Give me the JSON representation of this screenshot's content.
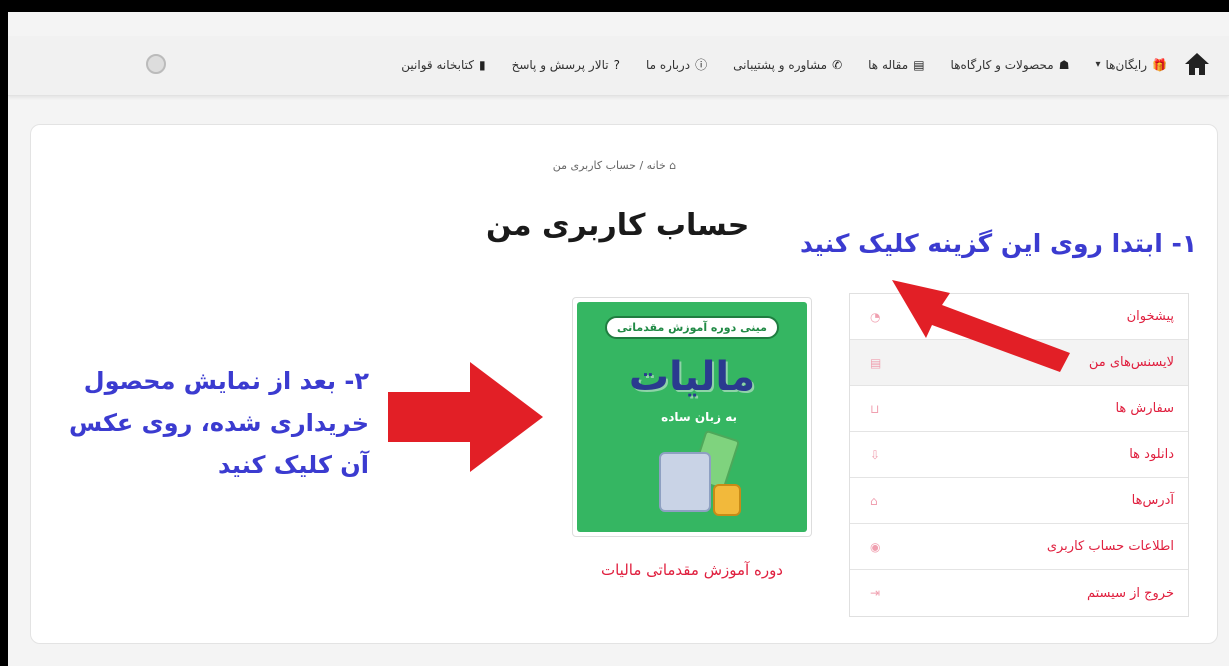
{
  "nav": {
    "items": [
      {
        "label": "رایگان‌ها",
        "icon": "gift-icon",
        "glyph": "🎁",
        "has_dropdown": true
      },
      {
        "label": "محصولات و کارگاه‌ها",
        "icon": "award-icon",
        "glyph": "☗"
      },
      {
        "label": "مقاله ها",
        "icon": "newspaper-icon",
        "glyph": "▤"
      },
      {
        "label": "مشاوره و پشتیبانی",
        "icon": "phone-icon",
        "glyph": "✆"
      },
      {
        "label": "درباره ما",
        "icon": "info-icon",
        "glyph": "ⓘ"
      },
      {
        "label": "تالار پرسش و پاسخ",
        "icon": "question-icon",
        "glyph": "?"
      },
      {
        "label": "کتابخانه قوانین",
        "icon": "books-icon",
        "glyph": "▮"
      }
    ],
    "dropdown_glyph": "▾"
  },
  "breadcrumb": {
    "home_icon": "⌂",
    "home": "خانه",
    "separator": "/",
    "current": "حساب کاربری من"
  },
  "page_title": "حساب کاربری من",
  "annotations": {
    "step1": "۱- ابتدا روی این گزینه کلیک کنید",
    "step2_line1": "۲- بعد از نمایش محصول",
    "step2_line2": "خریداری شده، روی عکس",
    "step2_line3": "آن کلیک کنید"
  },
  "account_menu": [
    {
      "label": "پیشخوان",
      "icon": "dashboard-icon",
      "glyph": "◔"
    },
    {
      "label": "لایسنس‌های من",
      "icon": "document-icon",
      "glyph": "▤",
      "active": true
    },
    {
      "label": "سفارش ها",
      "icon": "basket-icon",
      "glyph": "⊔"
    },
    {
      "label": "دانلود ها",
      "icon": "download-icon",
      "glyph": "⇩"
    },
    {
      "label": "آدرس‌ها",
      "icon": "home-icon",
      "glyph": "⌂"
    },
    {
      "label": "اطلاعات حساب کاربری",
      "icon": "user-icon",
      "glyph": "◉"
    },
    {
      "label": "خروج از سیستم",
      "icon": "logout-icon",
      "glyph": "⇥"
    }
  ],
  "product": {
    "badge": "مینی دوره آموزش مقدماتی",
    "big_text": "مالیات",
    "sub_text": "به زبان ساده",
    "title": "دوره آموزش مقدماتی مالیات"
  },
  "colors": {
    "accent": "#e0203f",
    "annotation": "#3b3bd0",
    "arrow": "#e21f26",
    "product_bg": "#35b662"
  }
}
